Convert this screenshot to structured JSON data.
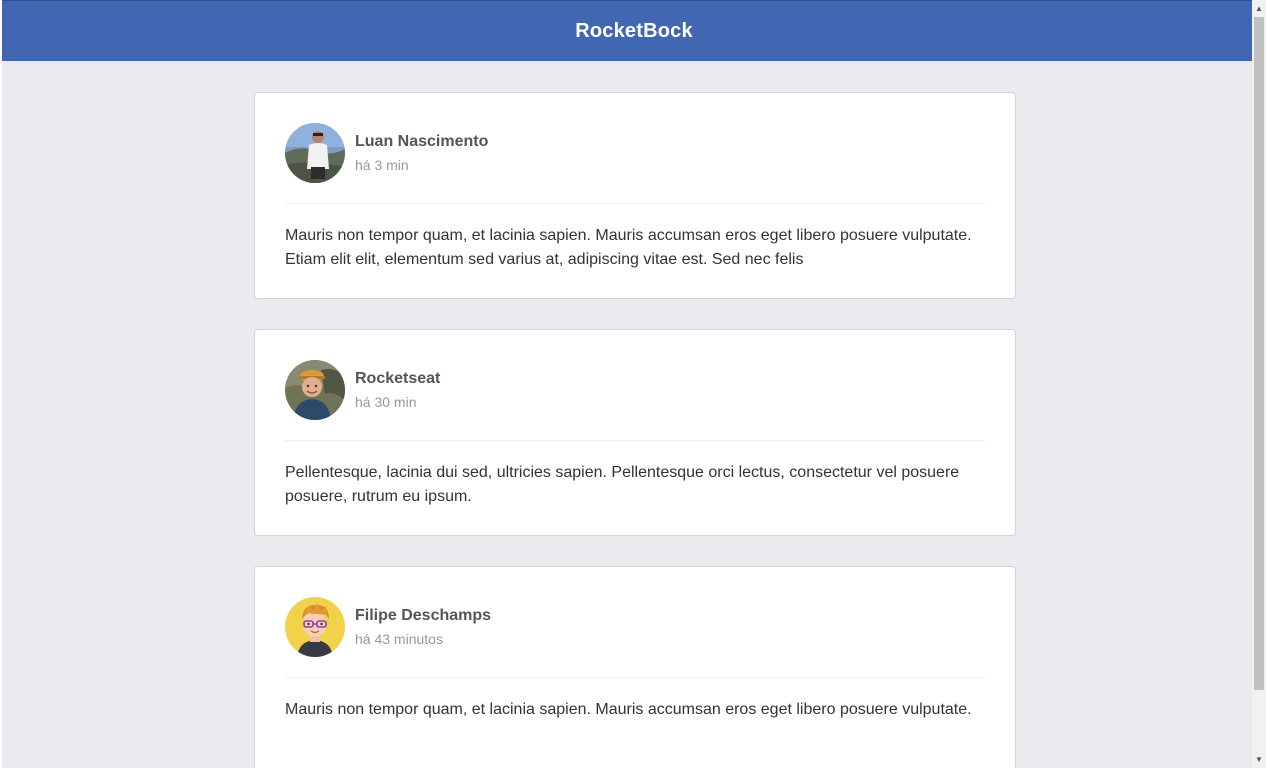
{
  "app": {
    "title": "RocketBock"
  },
  "posts": [
    {
      "author": "Luan Nascimento",
      "time": "há 3 min",
      "content": "Mauris non tempor quam, et lacinia sapien. Mauris accumsan eros eget libero posuere vulputate. Etiam elit elit, elementum sed varius at, adipiscing vitae est. Sed nec felis",
      "avatar_icon": "person-photo-icon"
    },
    {
      "author": "Rocketseat",
      "time": "há 30 min",
      "content": "Pellentesque, lacinia dui sed, ultricies sapien. Pellentesque orci lectus, consectetur vel posuere posuere, rutrum eu ipsum.",
      "avatar_icon": "person-photo-icon"
    },
    {
      "author": "Filipe Deschamps",
      "time": "há 43 minutos",
      "content": "Mauris non tempor quam, et lacinia sapien. Mauris accumsan eros eget libero posuere vulputate.",
      "avatar_icon": "cartoon-avatar-icon"
    }
  ],
  "colors": {
    "header": "#4267b2",
    "background": "#e9ebee",
    "card": "#ffffff"
  }
}
